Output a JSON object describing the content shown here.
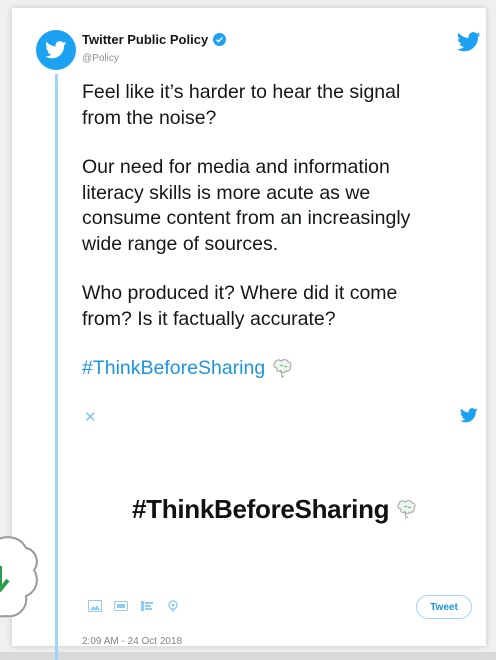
{
  "account": {
    "name": "Twitter Public Policy",
    "handle": "@Policy",
    "verified": true,
    "avatar_icon": "twitter-bird-icon"
  },
  "tweet": {
    "paragraphs": [
      "Feel like it’s harder to hear the signal\nfrom the noise?",
      "Our need for media and information\nliteracy skills is more acute as we\nconsume content from an increasingly\nwide range of sources.",
      "Who produced it? Where did it come\nfrom? Is it factually accurate?"
    ],
    "hashtag": "#ThinkBeforeSharing",
    "hashtag_emoji_icon": "brain-icon"
  },
  "media": {
    "banner_text": "#ThinkBeforeSharing",
    "banner_emoji_icon": "brain-icon",
    "top_left_icon": "close-icon",
    "top_right_icon": "twitter-bird-icon"
  },
  "composer": {
    "tools": [
      "image-icon",
      "gif-icon",
      "poll-icon",
      "location-icon"
    ],
    "tweet_button_label": "Tweet"
  },
  "timestamp": "2:09 AM - 24 Oct 2018",
  "colors": {
    "brand": "#1da1f2",
    "hashtag": "#1b95e0",
    "thread_line": "#9ed4f7"
  }
}
